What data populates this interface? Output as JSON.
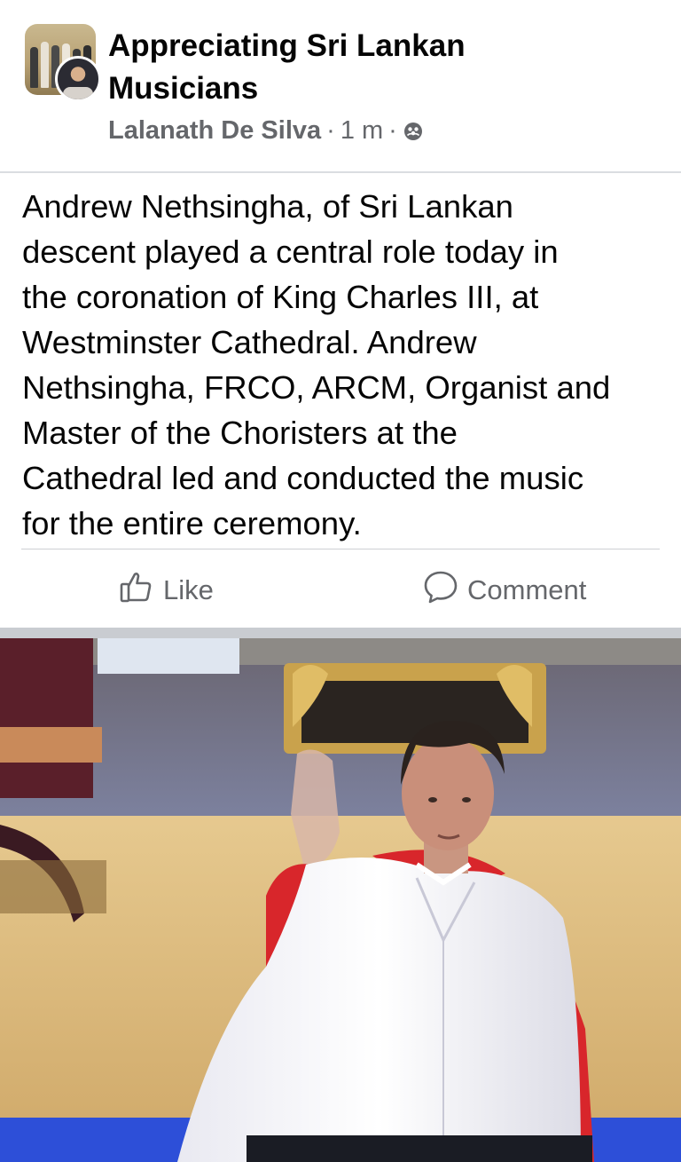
{
  "group": {
    "name": "Appreciating Sri Lankan Musicians"
  },
  "post": {
    "author": "Lalanath De Silva",
    "separator": "·",
    "time": "1 m",
    "privacy_icon": "group-members-icon",
    "text": "Andrew Nethsingha, of Sri Lankan\ndescent played a central role today in\nthe coronation of King Charles III, at\nWestminster Cathedral.  Andrew\nNethsingha, FRCO, ARCM, Organist and\nMaster of the Choristers at the\nCathedral led and conducted the music\nfor the entire ceremony."
  },
  "actions": {
    "like": "Like",
    "comment": "Comment"
  },
  "icons": {
    "like": "thumbs-up-icon",
    "comment": "speech-bubble-icon"
  },
  "colors": {
    "text": "#050505",
    "secondary": "#65676b",
    "divider": "#dadde1",
    "robe_red": "#d8262b"
  }
}
